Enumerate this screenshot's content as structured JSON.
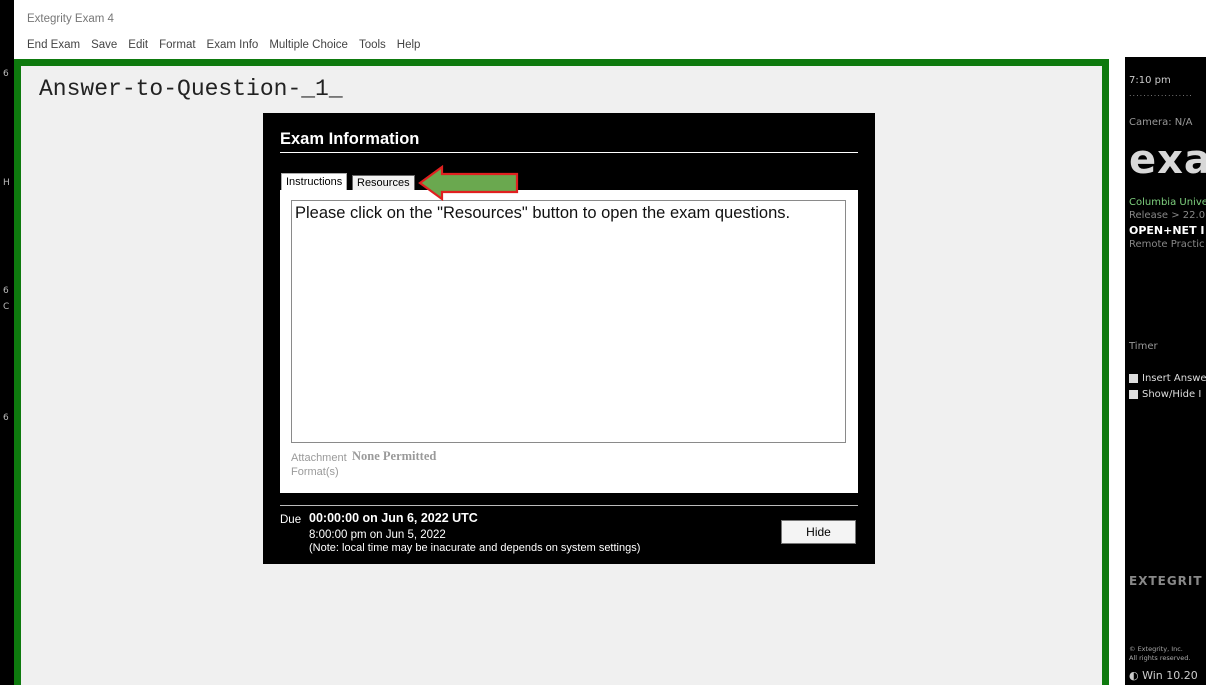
{
  "window": {
    "title": "Extegrity Exam 4"
  },
  "menu": [
    "End Exam",
    "Save",
    "Edit",
    "Format",
    "Exam Info",
    "Multiple Choice",
    "Tools",
    "Help"
  ],
  "left_strip_marks": [
    "6",
    "H",
    "6",
    "C",
    "6"
  ],
  "editor": {
    "heading": "Answer-to-Question-_1_"
  },
  "dialog": {
    "title": "Exam Information",
    "tabs": {
      "instructions": "Instructions",
      "resources": "Resources"
    },
    "instructions_text": "Please click on the \"Resources\" button to open the exam questions.",
    "attachment_label_1": "Attachment",
    "attachment_label_2": "Format(s)",
    "attachment_value": "None Permitted",
    "due_label": "Due",
    "due_utc": "00:00:00 on Jun 6, 2022 UTC",
    "due_local": "8:00:00 pm on Jun 5, 2022",
    "due_note": "(Note: local time may be inacurate and depends on system settings)",
    "hide_button": "Hide"
  },
  "annotation": {
    "arrow_fill": "#6aa84f",
    "arrow_stroke": "#e02020"
  },
  "side_panel": {
    "time": "7:10 pm",
    "dots": "..................",
    "camera": "Camera: N/A",
    "logo_text": "exa",
    "university": "Columbia Unive",
    "release": "Release > 22.0",
    "mode": "OPEN+NET I",
    "practice": "Remote Practic",
    "timer": "Timer",
    "checkbox_insert": "Insert Answe",
    "checkbox_showhide": "Show/Hide I",
    "brand": "EXTEGRIT",
    "copyright_1": "© Extegrity, Inc.",
    "copyright_2": "All rights reserved.",
    "os": "Win 10.20"
  },
  "colors": {
    "frame_green": "#0e7a0e",
    "university_green": "#7fd17f"
  }
}
